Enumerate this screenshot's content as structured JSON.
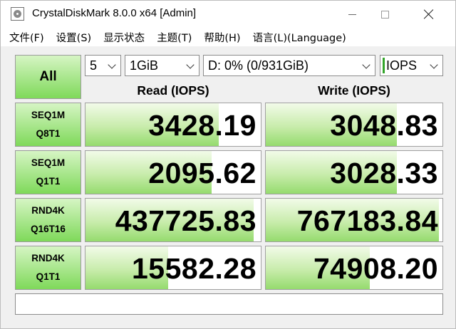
{
  "window": {
    "title": "CrystalDiskMark 8.0.0 x64 [Admin]",
    "app_icon": "disk-icon",
    "controls": {
      "minimize": "minimize-icon",
      "maximize": "maximize-icon",
      "close": "close-icon"
    }
  },
  "menu": [
    {
      "label": "文件(F)"
    },
    {
      "label": "设置(S)"
    },
    {
      "label": "显示状态"
    },
    {
      "label": "主题(T)"
    },
    {
      "label": "帮助(H)"
    },
    {
      "label": "语言(L)(Language)"
    }
  ],
  "controls": {
    "all_label": "All",
    "count": "5",
    "size": "1GiB",
    "drive": "D: 0% (0/931GiB)",
    "unit": "IOPS",
    "accent_color": "#33a52b"
  },
  "headers": {
    "read": "Read (IOPS)",
    "write": "Write (IOPS)"
  },
  "tests": [
    {
      "line1": "SEQ1M",
      "line2": "Q8T1",
      "read": "3428.19",
      "write": "3048.83",
      "read_fill": 0.76,
      "write_fill": 0.74
    },
    {
      "line1": "SEQ1M",
      "line2": "Q1T1",
      "read": "2095.62",
      "write": "3028.33",
      "read_fill": 0.72,
      "write_fill": 0.74
    },
    {
      "line1": "RND4K",
      "line2": "Q16T16",
      "read": "437725.83",
      "write": "767183.84",
      "read_fill": 0.96,
      "write_fill": 0.98
    },
    {
      "line1": "RND4K",
      "line2": "Q1T1",
      "read": "15582.28",
      "write": "74908.20",
      "read_fill": 0.47,
      "write_fill": 0.59
    }
  ],
  "status_text": "",
  "colors": {
    "bar_green": "#95db6e",
    "button_green": "#7fd95a"
  }
}
